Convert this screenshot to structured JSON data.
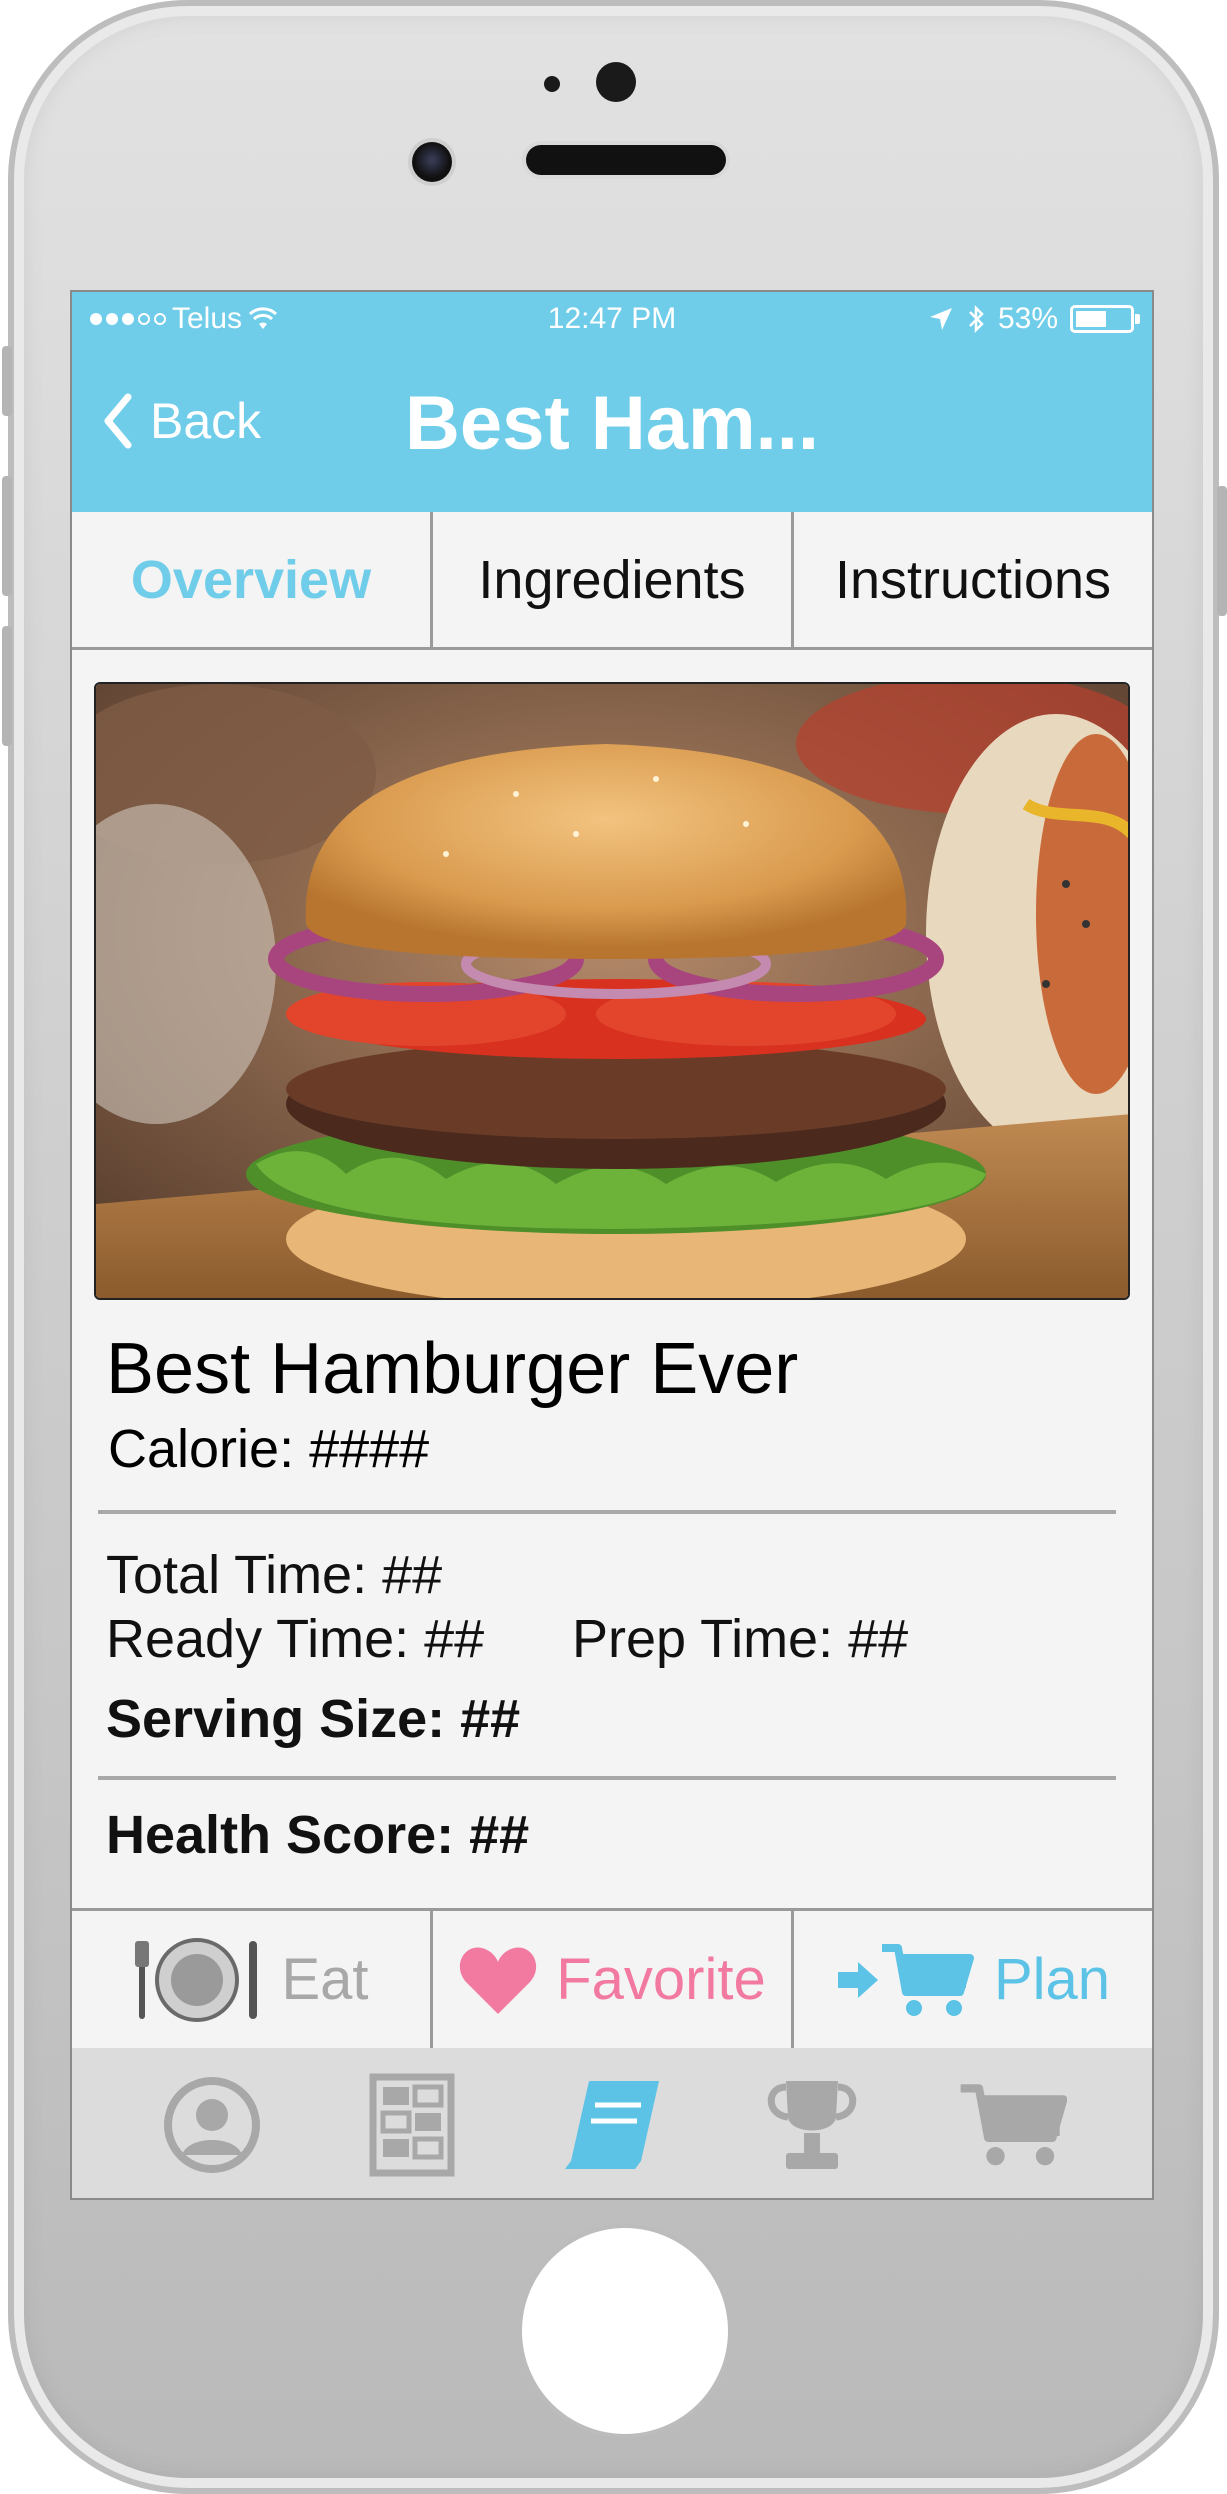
{
  "status_bar": {
    "carrier": "Telus",
    "time": "12:47 PM",
    "battery": "53%"
  },
  "nav": {
    "back_label": "Back",
    "title": "Best Ham..."
  },
  "tabs": [
    {
      "label": "Overview",
      "active": true
    },
    {
      "label": "Ingredients",
      "active": false
    },
    {
      "label": "Instructions",
      "active": false
    }
  ],
  "recipe": {
    "title": "Best Hamburger Ever",
    "calorie": "Calorie: ####",
    "total_time": "Total Time: ##",
    "ready_time": "Ready Time: ##",
    "prep_time": "Prep Time: ##",
    "serving_size": "Serving Size: ##",
    "health_score": "Health Score: ##"
  },
  "actions": [
    {
      "label": "Eat",
      "icon": "plate-icon",
      "color": "#a8a8a8"
    },
    {
      "label": "Favorite",
      "icon": "heart-icon",
      "color": "#f27aa0"
    },
    {
      "label": "Plan",
      "icon": "cart-arrow-icon",
      "color": "#5cc3e6"
    }
  ],
  "tab_bar": [
    {
      "icon": "profile-icon",
      "active": false
    },
    {
      "icon": "calendar-grid-icon",
      "active": false
    },
    {
      "icon": "recipe-book-icon",
      "active": true
    },
    {
      "icon": "trophy-icon",
      "active": false
    },
    {
      "icon": "shopping-cart-icon",
      "active": false
    }
  ],
  "colors": {
    "accent": "#70cdea",
    "favorite": "#f27aa0",
    "inactive": "#a8a8a8"
  }
}
